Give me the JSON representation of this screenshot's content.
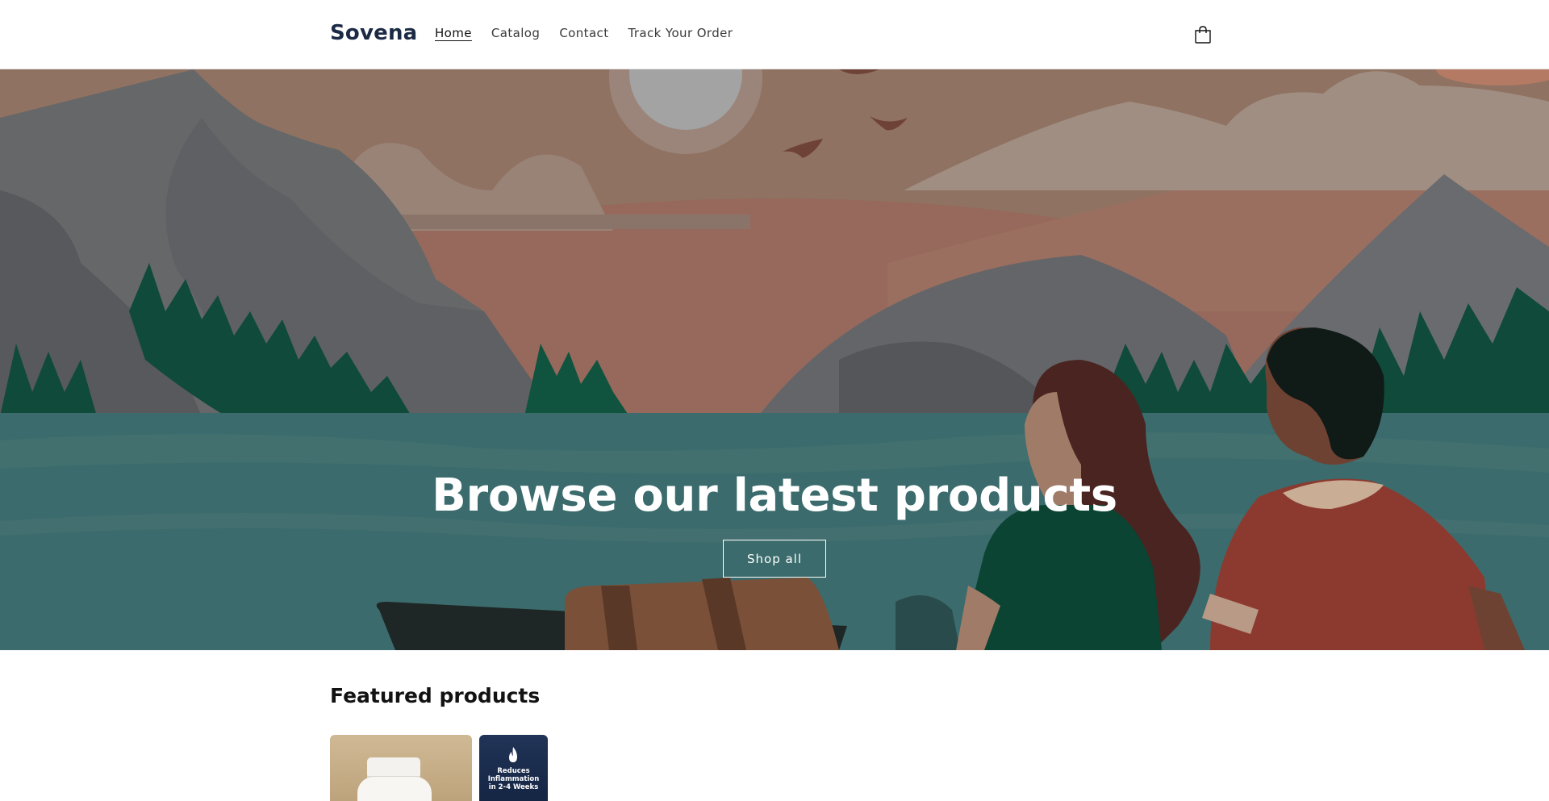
{
  "header": {
    "logo": "Sovena",
    "nav": [
      {
        "label": "Home",
        "active": true
      },
      {
        "label": "Catalog",
        "active": false
      },
      {
        "label": "Contact",
        "active": false
      },
      {
        "label": "Track Your Order",
        "active": false
      }
    ],
    "cart_icon": "cart-icon"
  },
  "hero": {
    "title": "Browse our latest products",
    "button_label": "Shop all"
  },
  "featured": {
    "title": "Featured products",
    "products": [
      {
        "image": "supplement-bottle"
      },
      {
        "image": "inflammation-badge",
        "line1": "Reduces",
        "line2": "Inflammation",
        "line3": "in 2-4 Weeks",
        "icon": "flame-icon"
      }
    ]
  },
  "colors": {
    "brand": "#1c2b45",
    "hero_water": "#3b6b6c",
    "hero_sky": "#8f7261",
    "button_border": "#ffffff"
  }
}
